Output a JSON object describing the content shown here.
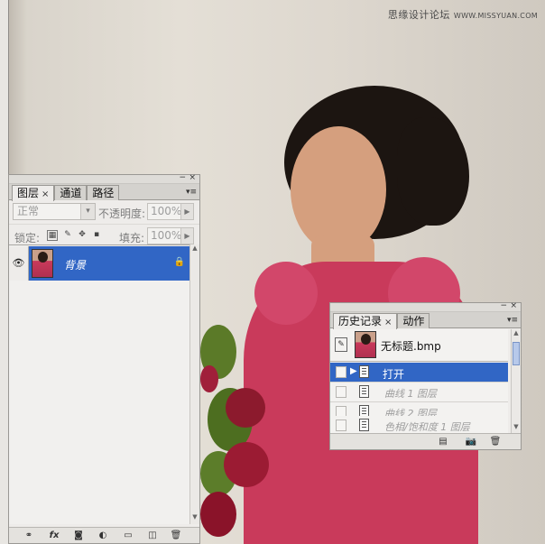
{
  "watermark": {
    "cn": "思缘设计论坛",
    "en": "WWW.MISSYUAN.COM"
  },
  "layers_panel": {
    "tabs": [
      {
        "label": "图层",
        "close": "×"
      },
      {
        "label": "通道"
      },
      {
        "label": "路径"
      }
    ],
    "window_buttons": {
      "minimize": "−",
      "close": "×"
    },
    "menu_icon": "▾≡",
    "blend_mode": "正常",
    "dropdown_arrow": "▾",
    "opacity_label": "不透明度:",
    "opacity_value": "100%",
    "lock_label": "锁定:",
    "fill_label": "填充:",
    "fill_value": "100%",
    "value_arrow": "▶",
    "layers": [
      {
        "name": "背景",
        "lock_icon": "🔒"
      }
    ],
    "eye_icon": "👁",
    "footer_icons": [
      "link-icon",
      "fx-icon",
      "mask-icon",
      "adjustment-icon",
      "folder-icon",
      "new-layer-icon",
      "trash-icon"
    ],
    "footer_glyphs": {
      "link": "⚭",
      "fx": "fx",
      "mask": "◙",
      "adjust": "◐",
      "folder": "▭",
      "new": "◫",
      "trash": "🗑"
    },
    "scroll_up": "▲",
    "scroll_down": "▼"
  },
  "history_panel": {
    "tabs": [
      {
        "label": "历史记录",
        "close": "×"
      },
      {
        "label": "动作"
      }
    ],
    "window_buttons": {
      "minimize": "−",
      "close": "×"
    },
    "menu_icon": "▾≡",
    "snapshot_name": "无标题.bmp",
    "slider_icon": "▶",
    "states": [
      {
        "label": "打开",
        "selected": true
      },
      {
        "label": "曲线 1 图层",
        "selected": false
      },
      {
        "label": "曲线 2 图层",
        "selected": false
      },
      {
        "label": "色相/饱和度 1 图层",
        "selected": false
      }
    ],
    "footer_glyphs": {
      "new_doc": "▤",
      "snapshot": "📷",
      "trash": "🗑"
    },
    "scroll_up": "▲",
    "scroll_down": "▼"
  },
  "colors": {
    "selection": "#3166c5",
    "panel_bg": "#eeecea",
    "dress": "#c93a5b"
  }
}
